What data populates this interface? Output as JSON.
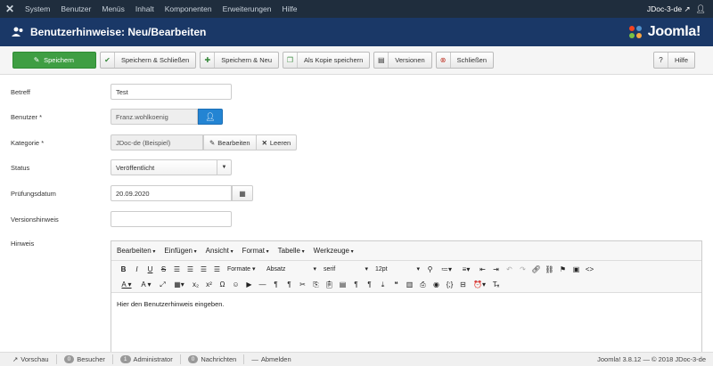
{
  "topnav": {
    "menu": [
      "System",
      "Benutzer",
      "Menüs",
      "Inhalt",
      "Komponenten",
      "Erweiterungen",
      "Hilfe"
    ],
    "site": "JDoc-3-de"
  },
  "titlebar": {
    "title": "Benutzerhinweise: Neu/Bearbeiten",
    "brand": "Joomla!"
  },
  "toolbar": {
    "save": "Speichern",
    "save_close": "Speichern & Schließen",
    "save_new": "Speichern & Neu",
    "save_copy": "Als Kopie speichern",
    "versions": "Versionen",
    "close": "Schließen",
    "help": "Hilfe"
  },
  "form": {
    "subject": {
      "label": "Betreff",
      "value": "Test"
    },
    "user": {
      "label": "Benutzer *",
      "value": "Franz.wohlkoenig"
    },
    "category": {
      "label": "Kategorie *",
      "value": "JDoc-de (Beispiel)",
      "edit": "Bearbeiten",
      "clear": "Leeren"
    },
    "status": {
      "label": "Status",
      "value": "Veröffentlicht"
    },
    "review": {
      "label": "Prüfungsdatum",
      "value": "20.09.2020"
    },
    "version": {
      "label": "Versionshinweis",
      "value": ""
    },
    "note": {
      "label": "Hinweis"
    }
  },
  "editor": {
    "menus": [
      "Bearbeiten",
      "Einfügen",
      "Ansicht",
      "Format",
      "Tabelle",
      "Werkzeuge"
    ],
    "formats": "Formate",
    "block": "Absatz",
    "font": "serif",
    "size": "12pt",
    "body": "Hier den Benutzerhinweis eingeben."
  },
  "statusbar": {
    "preview": "Vorschau",
    "visitors_count": "0",
    "visitors": "Besucher",
    "admin_count": "1",
    "admin": "Administrator",
    "messages_count": "0",
    "messages": "Nachrichten",
    "logout": "Abmelden",
    "version": "Joomla! 3.8.12",
    "copyright": "— © 2018 JDoc-3-de"
  },
  "colors": {
    "nav": "#1f2d3d",
    "title": "#1a3867",
    "save": "#3f9e43",
    "user_button": "#2384d3"
  }
}
